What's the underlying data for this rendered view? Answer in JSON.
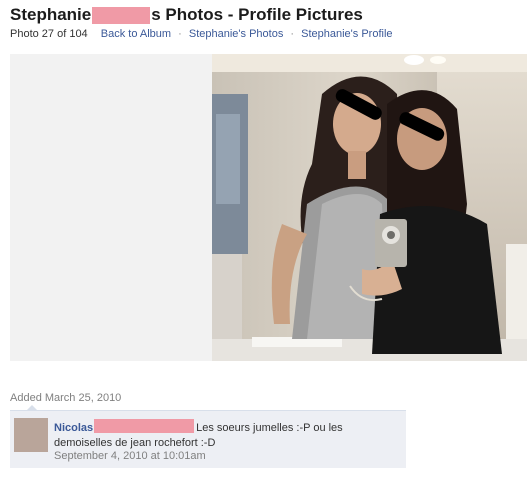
{
  "header": {
    "title_part1": "Stephanie",
    "title_part2": "s Photos - Profile Pictures"
  },
  "subnav": {
    "photo_count": "Photo 27 of 104",
    "back_to_album": "Back to Album",
    "separator": "·",
    "photos_link": "Stephanie's Photos",
    "profile_link": "Stephanie's Profile"
  },
  "photo": {
    "censor_bar_color": "#000000",
    "redaction_color": "#f09aa6"
  },
  "meta": {
    "added": "Added March 25, 2010"
  },
  "comment": {
    "author": "Nicolas",
    "text_line1": "Les soeurs jumelles :-P ou les",
    "text_line2": "demoiselles de jean rochefort :-D",
    "timestamp": "September 4, 2010 at 10:01am"
  },
  "colors": {
    "link": "#3b5998",
    "comment_bg": "#edeff4",
    "muted_text": "#808080"
  }
}
